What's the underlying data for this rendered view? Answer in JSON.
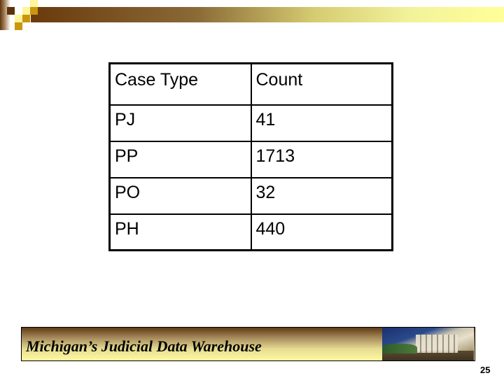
{
  "slide": {
    "table": {
      "headers": [
        "Case Type",
        "Count"
      ],
      "rows": [
        [
          "PJ",
          "41"
        ],
        [
          "PP",
          "1713"
        ],
        [
          "PO",
          "32"
        ],
        [
          "PH",
          "440"
        ]
      ]
    },
    "footer": {
      "title": "Michigan’s Judicial Data Warehouse",
      "photo": "courthouse-building-photo"
    },
    "page_number": "25",
    "colors": {
      "brand_dark_brown": "#5c3208",
      "brand_gold": "#c9960e",
      "brand_light_yellow": "#fff59a"
    }
  }
}
